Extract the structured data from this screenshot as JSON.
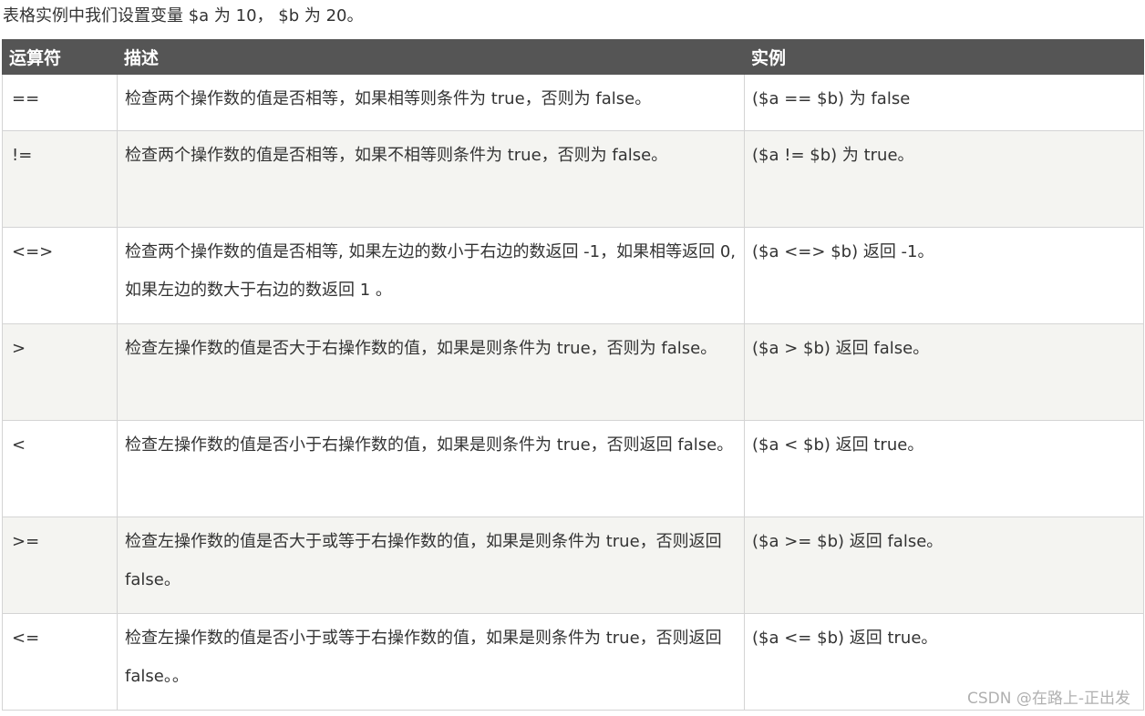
{
  "intro": "表格实例中我们设置变量 $a 为 10， $b 为 20。",
  "table": {
    "headers": [
      "运算符",
      "描述",
      "实例"
    ],
    "rows": [
      {
        "op": "==",
        "desc": "检查两个操作数的值是否相等，如果相等则条件为 true，否则为 false。",
        "example": "($a == $b) 为 false"
      },
      {
        "op": "!=",
        "desc": "检查两个操作数的值是否相等，如果不相等则条件为 true，否则为 false。",
        "example": "($a != $b) 为 true。"
      },
      {
        "op": "<=>",
        "desc": "检查两个操作数的值是否相等, 如果左边的数小于右边的数返回 -1，如果相等返回 0, 如果左边的数大于右边的数返回 1 。",
        "example": "($a <=> $b) 返回 -1。"
      },
      {
        "op": ">",
        "desc": "检查左操作数的值是否大于右操作数的值，如果是则条件为 true，否则为 false。",
        "example": "($a > $b) 返回 false。"
      },
      {
        "op": "<",
        "desc": "检查左操作数的值是否小于右操作数的值，如果是则条件为 true，否则返回 false。",
        "example": "($a < $b) 返回 true。"
      },
      {
        "op": ">=",
        "desc": "检查左操作数的值是否大于或等于右操作数的值，如果是则条件为 true，否则返回 false。",
        "example": "($a >= $b) 返回 false。"
      },
      {
        "op": "<=",
        "desc": "检查左操作数的值是否小于或等于右操作数的值，如果是则条件为 true，否则返回 false。。",
        "example": "($a <= $b) 返回 true。"
      }
    ]
  },
  "watermark": "CSDN @在路上-正出发"
}
